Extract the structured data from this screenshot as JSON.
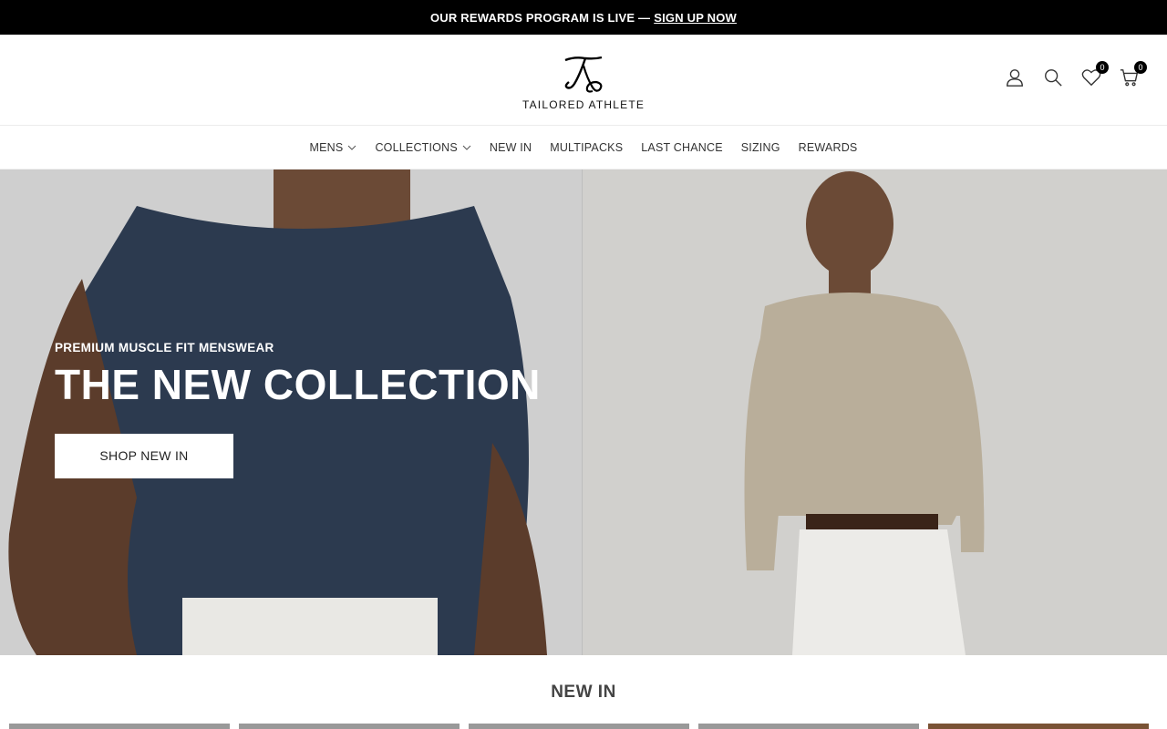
{
  "announcement": {
    "text": "OUR REWARDS PROGRAM IS LIVE —",
    "link": "SIGN UP NOW"
  },
  "brand": {
    "name": "TAILORED ATHLETE"
  },
  "header": {
    "icons": [
      "account-icon",
      "search-icon",
      "wishlist-icon",
      "cart-icon"
    ],
    "wishlist_count": "0",
    "cart_count": "0"
  },
  "nav": {
    "items": [
      "MENS",
      "COLLECTIONS",
      "NEW IN",
      "MULTIPACKS",
      "LAST CHANCE",
      "SIZING",
      "REWARDS"
    ]
  },
  "hero": {
    "eyebrow": "PREMIUM MUSCLE FIT MENSWEAR",
    "headline": "THE NEW COLLECTION",
    "cta": "SHOP NEW IN"
  },
  "section": {
    "title": "NEW IN"
  },
  "colors": {
    "announce_bg": "#000000",
    "hero_left": "#cfcfcf",
    "hero_right": "#d1d0cd",
    "tee": "#2c3a4f",
    "polo": "#b9ae9a"
  }
}
